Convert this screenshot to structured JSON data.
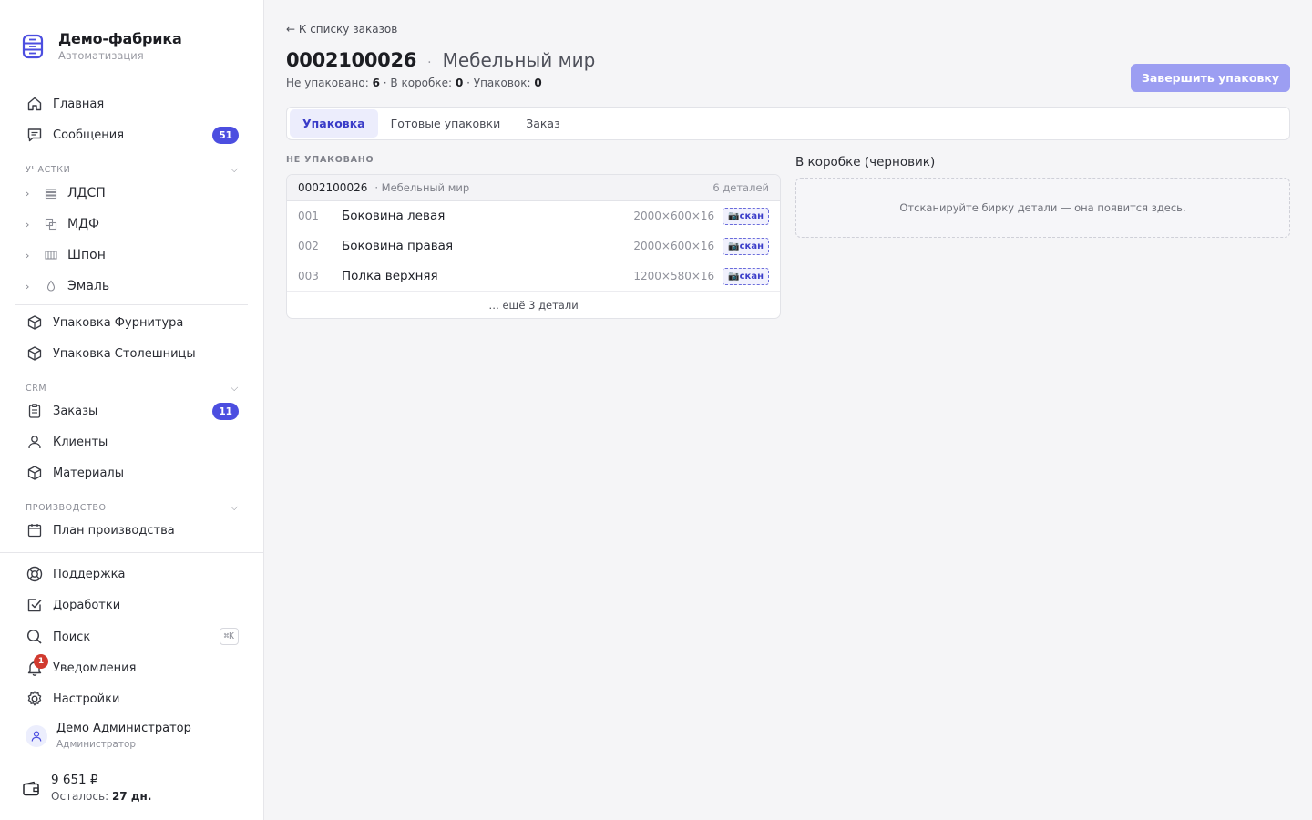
{
  "brand": {
    "title": "Демо-фабрика",
    "subtitle": "Автоматизация"
  },
  "nav_top": [
    {
      "label": "Главная",
      "icon": "home-icon"
    },
    {
      "label": "Сообщения",
      "icon": "chat-icon",
      "badge": "51"
    }
  ],
  "sections": {
    "areas": "УЧАСТКИ",
    "crm": "CRM",
    "production": "ПРОИЗВОДСТВО"
  },
  "areas": [
    {
      "label": "ЛДСП"
    },
    {
      "label": "МДФ"
    },
    {
      "label": "Шпон"
    },
    {
      "label": "Эмаль"
    }
  ],
  "packing_items": [
    {
      "label": "Упаковка Фурнитура"
    },
    {
      "label": "Упаковка Столешницы"
    }
  ],
  "crm_items": [
    {
      "label": "Заказы",
      "badge": "11"
    },
    {
      "label": "Клиенты"
    },
    {
      "label": "Материалы"
    }
  ],
  "production_items": [
    {
      "label": "План производства"
    }
  ],
  "bottom_items": {
    "support": "Поддержка",
    "improvements": "Доработки",
    "search": "Поиск",
    "search_shortcut": "⌘K",
    "notifications": "Уведомления",
    "notifications_count": "1",
    "settings": "Настройки"
  },
  "user": {
    "name": "Демо Администратор",
    "role": "Администратор"
  },
  "wallet": {
    "amount": "9 651 ₽",
    "remaining_label": "Осталось:",
    "remaining_value": "27 дн."
  },
  "page": {
    "back_link": "← К списку заказов",
    "order_number": "0002100026",
    "separator": "·",
    "client": "Мебельный мир",
    "stats": {
      "not_packed_label": "Не упаковано:",
      "not_packed": "6",
      "in_box_label": "· В коробке:",
      "in_box": "0",
      "packs_label": "· Упаковок:",
      "packs": "0"
    },
    "finish_button": "Завершить упаковку",
    "tabs": [
      "Упаковка",
      "Готовые упаковки",
      "Заказ"
    ]
  },
  "unpacked": {
    "title": "НЕ УПАКОВАНО",
    "order_number": "0002100026",
    "client": "· Мебельный мир",
    "count": "6 деталей",
    "parts": [
      {
        "idx": "001",
        "name": "Боковина левая",
        "dims": "2000×600×16",
        "scan": "📷скан"
      },
      {
        "idx": "002",
        "name": "Боковина правая",
        "dims": "2000×600×16",
        "scan": "📷скан"
      },
      {
        "idx": "003",
        "name": "Полка верхняя",
        "dims": "1200×580×16",
        "scan": "📷скан"
      }
    ],
    "more": "… ещё 3 детали"
  },
  "box": {
    "title": "В коробке (черновик)",
    "placeholder": "Отсканируйте бирку детали — она появится здесь."
  },
  "colors": {
    "accent": "#4c4ee0",
    "button_disabled": "#9c9ef2",
    "notification": "#d13a2f"
  }
}
